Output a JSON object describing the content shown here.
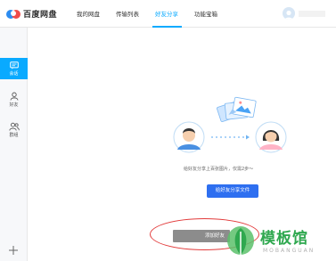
{
  "app": {
    "name": "百度网盘"
  },
  "nav": [
    {
      "label": "我的网盘",
      "active": false
    },
    {
      "label": "传输列表",
      "active": false
    },
    {
      "label": "好友分享",
      "active": true
    },
    {
      "label": "功能宝箱",
      "active": false
    }
  ],
  "sidebar": {
    "items": [
      {
        "label": "会话",
        "icon": "chat-icon",
        "active": true
      },
      {
        "label": "好友",
        "icon": "person-icon",
        "active": false
      },
      {
        "label": "群组",
        "icon": "group-icon",
        "active": false
      }
    ],
    "add_icon": "plus-icon"
  },
  "main": {
    "hint": "给好友分享上百张图片，仅需2步～",
    "share_button": "给好友分享文件",
    "add_friend_button": "添加好友"
  },
  "watermark": {
    "title": "模板馆",
    "subtitle": "MOBANGUAN"
  },
  "colors": {
    "accent": "#09aaff",
    "button_blue": "#2e6ff0",
    "highlight_red": "#e23b3b",
    "watermark_green": "#2fa84f"
  }
}
